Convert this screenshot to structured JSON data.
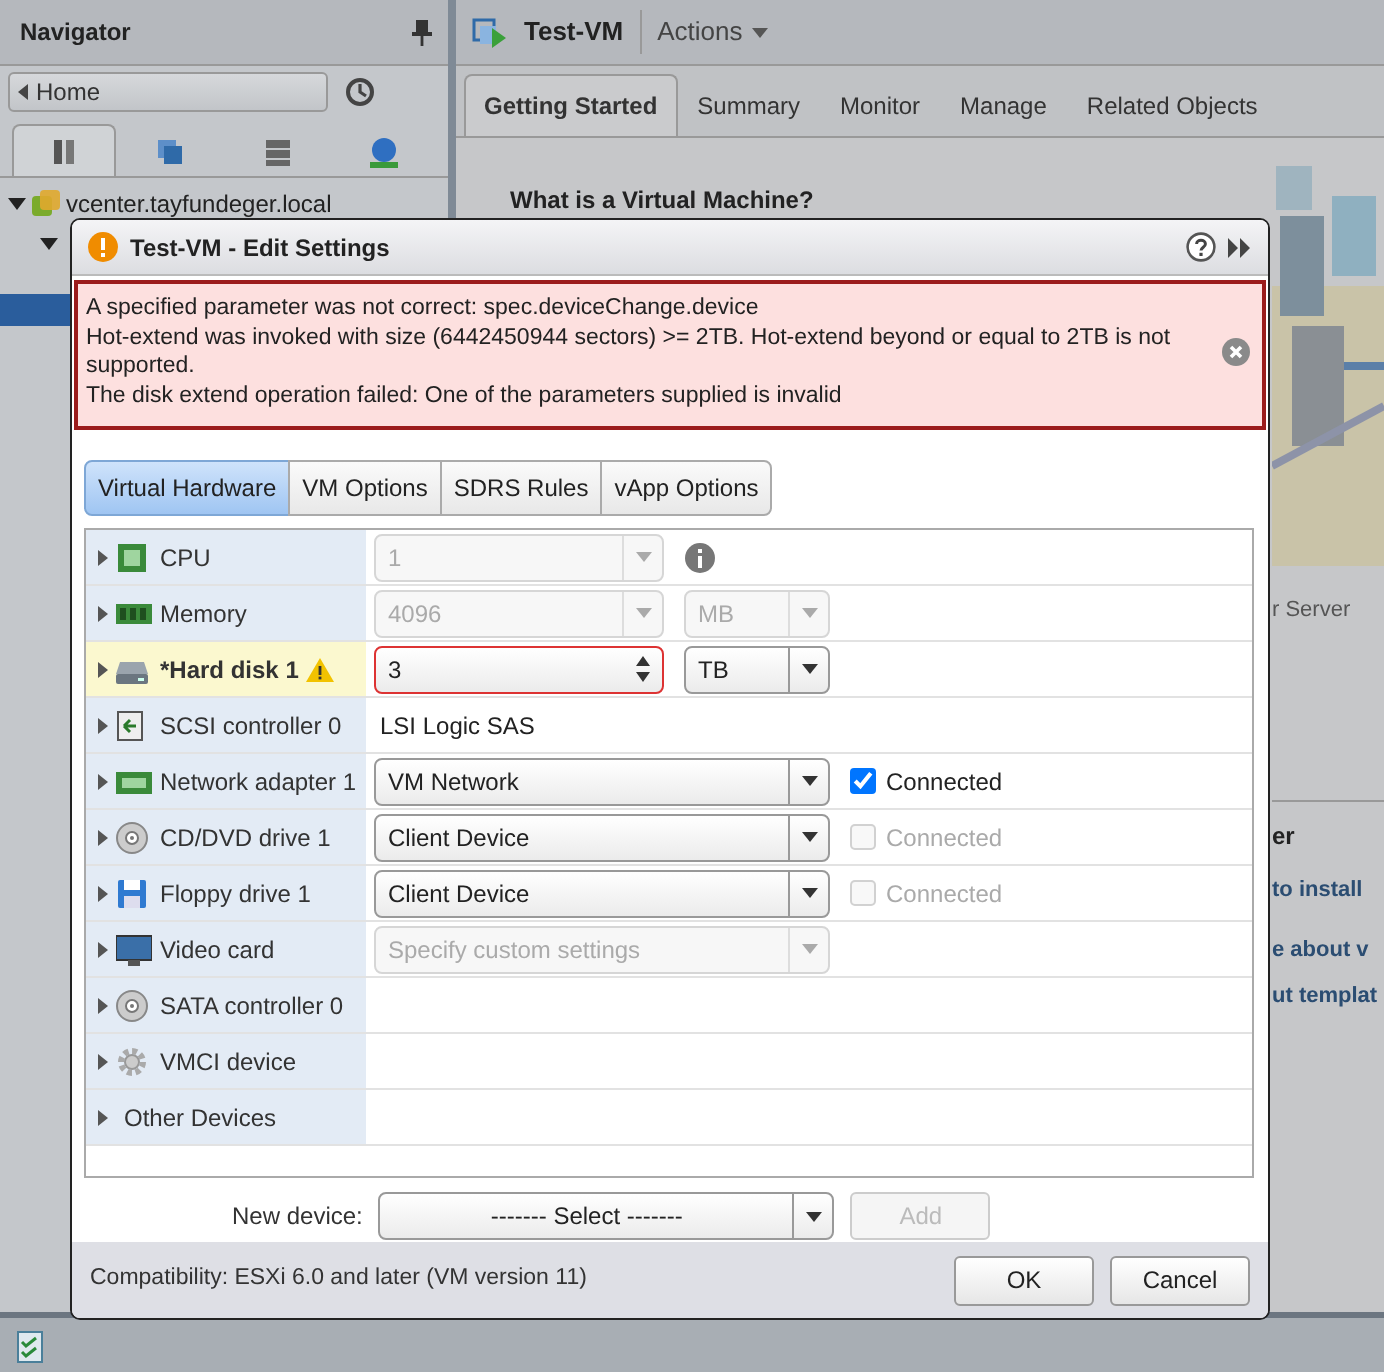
{
  "navigator": {
    "title": "Navigator",
    "home": "Home",
    "view_tabs": [
      {
        "selected": true
      },
      {
        "selected": false
      },
      {
        "selected": false
      },
      {
        "selected": false
      }
    ],
    "tree": [
      {
        "label": "vcenter.tayfundeger.local",
        "expanded": true,
        "children": [
          {
            "expanded": true
          }
        ]
      }
    ]
  },
  "main": {
    "title": "Test-VM",
    "actions": "Actions",
    "tabs": [
      {
        "label": "Getting Started",
        "selected": true
      },
      {
        "label": "Summary",
        "selected": false
      },
      {
        "label": "Monitor",
        "selected": false
      },
      {
        "label": "Manage",
        "selected": false
      },
      {
        "label": "Related Objects",
        "selected": false
      }
    ],
    "heading": "What is a Virtual Machine?",
    "fragments": [
      {
        "text": "r Server",
        "kind": "caption"
      },
      {
        "text": "er",
        "kind": "heading"
      },
      {
        "text": "to install",
        "kind": "link"
      },
      {
        "text": "e about v",
        "kind": "link"
      },
      {
        "text": "ut templat",
        "kind": "link"
      }
    ]
  },
  "dialog": {
    "title": "Test-VM - Edit Settings",
    "error": [
      "A specified parameter was not correct: spec.deviceChange.device",
      "Hot-extend was invoked with size (6442450944 sectors) >= 2TB. Hot-extend beyond or equal to 2TB is not supported.",
      "The disk extend operation failed: One of the parameters supplied is invalid"
    ],
    "tabs": [
      {
        "label": "Virtual Hardware",
        "selected": true
      },
      {
        "label": "VM Options",
        "selected": false
      },
      {
        "label": "SDRS Rules",
        "selected": false
      },
      {
        "label": "vApp Options",
        "selected": false
      }
    ],
    "devices": [
      {
        "label": "CPU",
        "kind": "cpu",
        "modified": false,
        "warning": false,
        "info": true,
        "field": {
          "kind": "select",
          "value": "1",
          "disabled": true
        }
      },
      {
        "label": "Memory",
        "kind": "memory",
        "modified": false,
        "warning": false,
        "info": false,
        "field": {
          "kind": "select",
          "value": "4096",
          "disabled": true
        },
        "unit": {
          "value": "MB",
          "disabled": true
        }
      },
      {
        "label": "*Hard disk 1",
        "kind": "disk",
        "modified": true,
        "warning": true,
        "info": false,
        "field": {
          "kind": "spinner",
          "value": "3",
          "disabled": false,
          "invalid": true
        },
        "unit": {
          "value": "TB",
          "disabled": false
        }
      },
      {
        "label": "SCSI controller 0",
        "kind": "controller",
        "modified": false,
        "warning": false,
        "info": false,
        "field": {
          "kind": "text",
          "value": "LSI Logic SAS"
        }
      },
      {
        "label": "Network adapter 1",
        "kind": "network",
        "modified": false,
        "warning": false,
        "info": false,
        "field": {
          "kind": "select",
          "value": "VM Network",
          "disabled": false
        },
        "connected": {
          "label": "Connected",
          "checked": true,
          "disabled": false
        }
      },
      {
        "label": "CD/DVD drive 1",
        "kind": "cdrom",
        "modified": false,
        "warning": false,
        "info": false,
        "field": {
          "kind": "select",
          "value": "Client Device",
          "disabled": false
        },
        "connected": {
          "label": "Connected",
          "checked": false,
          "disabled": true
        }
      },
      {
        "label": "Floppy drive 1",
        "kind": "floppy",
        "modified": false,
        "warning": false,
        "info": false,
        "field": {
          "kind": "select",
          "value": "Client Device",
          "disabled": false
        },
        "connected": {
          "label": "Connected",
          "checked": false,
          "disabled": true
        }
      },
      {
        "label": "Video card",
        "kind": "video",
        "modified": false,
        "warning": false,
        "info": false,
        "field": {
          "kind": "select",
          "placeholder": "Specify custom settings",
          "disabled": true
        }
      },
      {
        "label": "SATA controller 0",
        "kind": "cdrom",
        "modified": false,
        "warning": false,
        "info": false
      },
      {
        "label": "VMCI device",
        "kind": "vmci",
        "modified": false,
        "warning": false,
        "info": false
      },
      {
        "label": "Other Devices",
        "kind": "other",
        "modified": false,
        "warning": false,
        "info": false
      }
    ],
    "new_device": {
      "label": "New device:",
      "value": "------- Select -------",
      "add": "Add",
      "add_disabled": true
    },
    "compatibility": "Compatibility: ESXi 6.0 and later (VM version 11)",
    "buttons": [
      "OK",
      "Cancel"
    ]
  }
}
